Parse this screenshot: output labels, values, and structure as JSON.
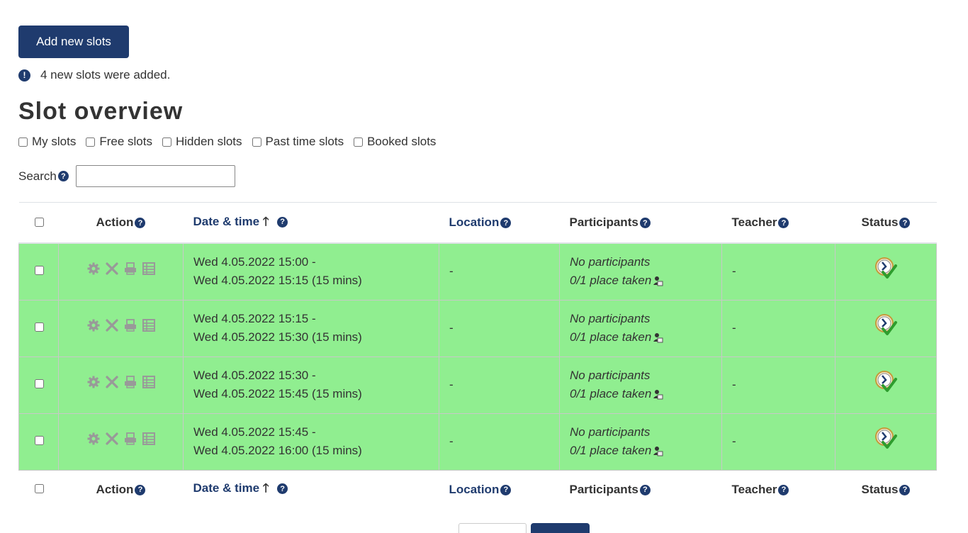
{
  "buttons": {
    "add_new_slots": "Add new slots"
  },
  "notice": {
    "message": "4 new slots were added."
  },
  "title": "Slot overview",
  "filters": [
    {
      "label": "My slots",
      "checked": false
    },
    {
      "label": "Free slots",
      "checked": false
    },
    {
      "label": "Hidden slots",
      "checked": false
    },
    {
      "label": "Past time slots",
      "checked": false
    },
    {
      "label": "Booked slots",
      "checked": false
    }
  ],
  "search": {
    "label": "Search",
    "value": "",
    "placeholder": ""
  },
  "table": {
    "headers": {
      "action": "Action",
      "datetime": "Date & time",
      "location": "Location",
      "participants": "Participants",
      "teacher": "Teacher",
      "status": "Status"
    },
    "sort_arrow": "🡑",
    "rows": [
      {
        "start": "Wed 4.05.2022 15:00 -",
        "end": "Wed 4.05.2022 15:15 (15 mins)",
        "location": "-",
        "participants": "No participants",
        "places": "0/1 place taken",
        "teacher": "-"
      },
      {
        "start": "Wed 4.05.2022 15:15 -",
        "end": "Wed 4.05.2022 15:30 (15 mins)",
        "location": "-",
        "participants": "No participants",
        "places": "0/1 place taken",
        "teacher": "-"
      },
      {
        "start": "Wed 4.05.2022 15:30 -",
        "end": "Wed 4.05.2022 15:45 (15 mins)",
        "location": "-",
        "participants": "No participants",
        "places": "0/1 place taken",
        "teacher": "-"
      },
      {
        "start": "Wed 4.05.2022 15:45 -",
        "end": "Wed 4.05.2022 16:00 (15 mins)",
        "location": "-",
        "participants": "No participants",
        "places": "0/1 place taken",
        "teacher": "-"
      }
    ],
    "row_icons": [
      "gear-icon",
      "delete-icon",
      "print-icon",
      "grid-icon"
    ],
    "status_icon": "clock-check-icon"
  },
  "colors": {
    "primary": "#1f3b6e",
    "row_background": "#90ee90",
    "icon_gray": "#999999"
  }
}
